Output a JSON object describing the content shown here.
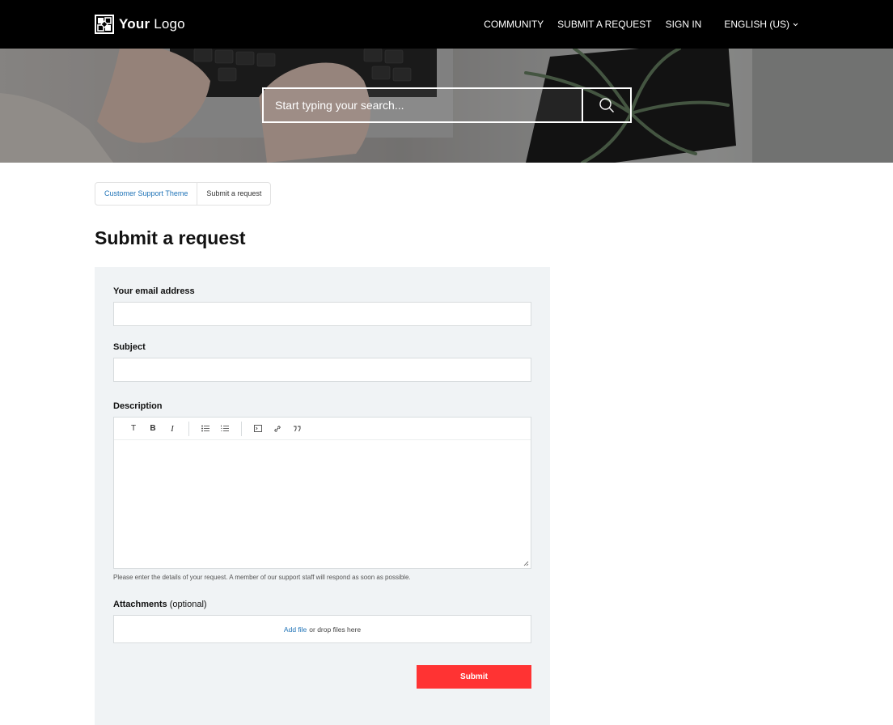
{
  "header": {
    "logo_text_bold": "Your",
    "logo_text_light": "Logo",
    "nav": [
      {
        "label": "COMMUNITY"
      },
      {
        "label": "SUBMIT A REQUEST"
      },
      {
        "label": "SIGN IN"
      }
    ],
    "language": "ENGLISH (US)",
    "icons": {
      "logo": "logo-mark-icon",
      "language": "chevron-down-icon"
    }
  },
  "hero": {
    "search_placeholder": "Start typing your search...",
    "search_icon": "search-icon"
  },
  "breadcrumb": [
    {
      "label": "Customer Support Theme"
    },
    {
      "label": "Submit a request"
    }
  ],
  "page_title": "Submit a request",
  "form": {
    "email_label": "Your email address",
    "email_value": "",
    "subject_label": "Subject",
    "subject_value": "",
    "description_label": "Description",
    "toolbar": [
      "text-format-icon",
      "bold-icon",
      "italic-icon",
      "bullet-list-icon",
      "numbered-list-icon",
      "code-block-icon",
      "link-icon",
      "quote-icon"
    ],
    "toolbar_glyphs": {
      "text": "T",
      "bold": "B",
      "italic": "I"
    },
    "description_hint": "Please enter the details of your request. A member of our support staff will respond as soon as possible.",
    "attachments_label": "Attachments",
    "attachments_optional": "(optional)",
    "add_file_link": "Add file",
    "drop_text": "or drop files here",
    "submit_label": "Submit"
  },
  "colors": {
    "header_bg": "#000000",
    "accent_link": "#1f73b7",
    "submit_bg": "#ff3333",
    "panel_bg": "#f0f3f5"
  }
}
